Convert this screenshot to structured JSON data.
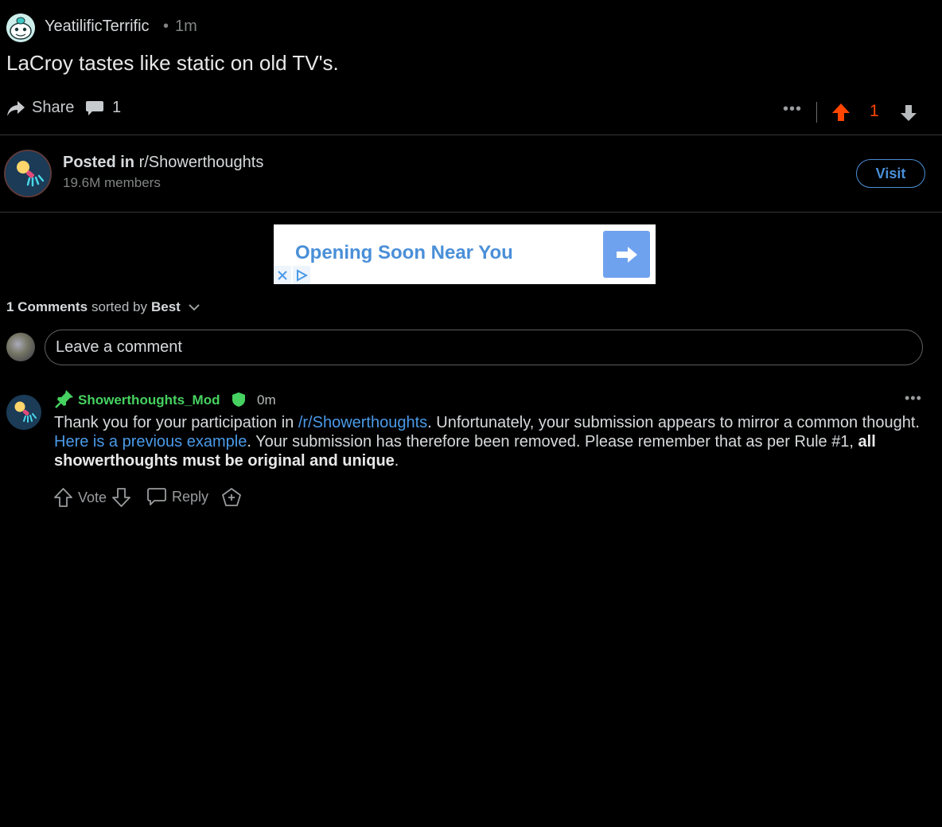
{
  "post": {
    "author": "YeatilificTerrific",
    "separator": "•",
    "time": "1m",
    "title": "LaCroy tastes like static on old TV's.",
    "share_label": "Share",
    "comment_count": "1",
    "more_label": "•••",
    "score": "1",
    "upvote_color": "#ff4500"
  },
  "subreddit": {
    "posted_in_label": "Posted in",
    "name": "r/Showerthoughts",
    "members": "19.6M members",
    "visit_label": "Visit"
  },
  "ad": {
    "headline": "Opening Soon Near You",
    "accent_color": "#6fa2ee"
  },
  "comments": {
    "count_label": "1 Comments",
    "sorted_by_label": "sorted by",
    "sort_value": "Best",
    "input_placeholder": "Leave a comment",
    "items": [
      {
        "author": "Showerthoughts_Mod",
        "time": "0m",
        "more_label": "•••",
        "body_part1": "Thank you for your participation in ",
        "link1": "/r/Showerthoughts",
        "body_part2": ". Unfortunately, your submission appears to mirror a common thought. ",
        "link2": "Here is a previous example",
        "body_part3": ". Your submission has therefore been removed. Please remember that as per Rule #1, ",
        "bold_text": "all showerthoughts must be original and unique",
        "body_part4": ".",
        "vote_label": "Vote",
        "reply_label": "Reply"
      }
    ]
  }
}
